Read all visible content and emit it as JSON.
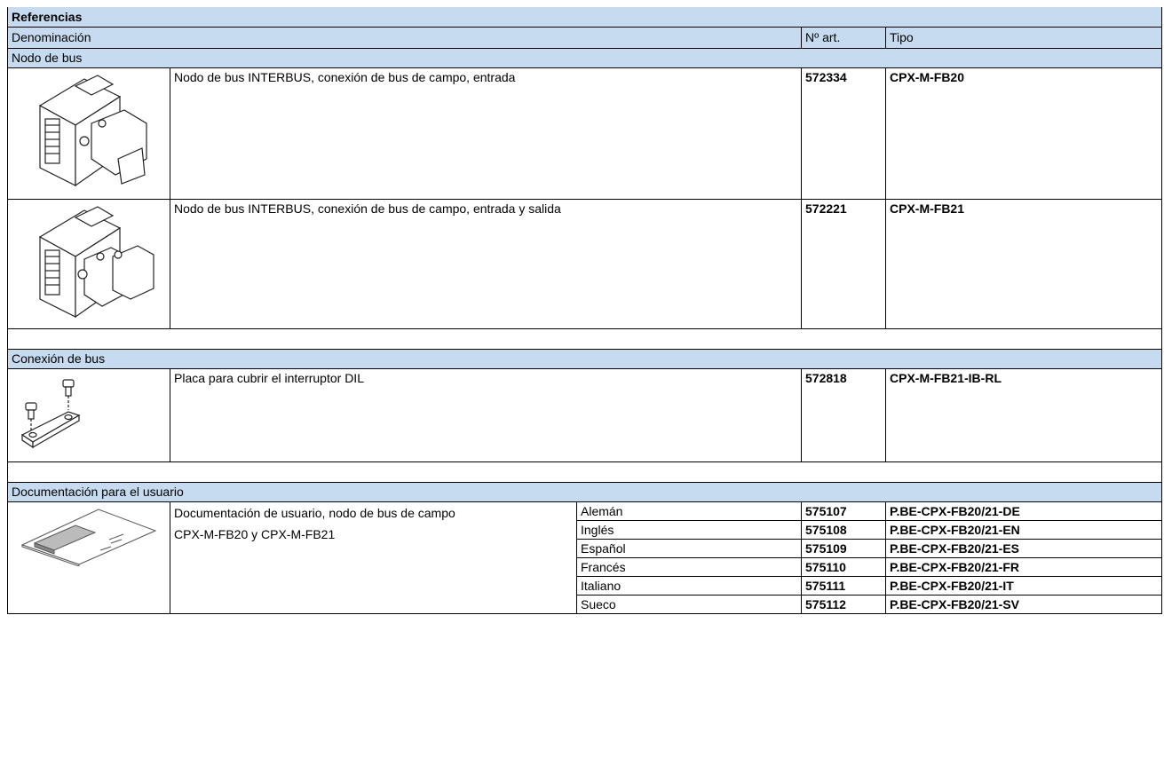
{
  "table": {
    "title": "Referencias",
    "columns": {
      "denominacion": "Denominación",
      "art": "Nº art.",
      "tipo": "Tipo"
    },
    "sections": [
      {
        "label": "Nodo de bus",
        "rows": [
          {
            "image": "bus-node-module-icon",
            "desc": "Nodo de bus INTERBUS, conexión de bus de campo, entrada",
            "art": "572334",
            "tipo": "CPX-M-FB20"
          },
          {
            "image": "bus-node-module-icon",
            "desc": "Nodo de bus INTERBUS, conexión de bus de campo, entrada y salida",
            "art": "572221",
            "tipo": "CPX-M-FB21"
          }
        ]
      },
      {
        "label": "Conexión de bus",
        "rows": [
          {
            "image": "cover-plate-icon",
            "desc": "Placa para cubrir el interruptor DIL",
            "art": "572818",
            "tipo": "CPX-M-FB21-IB-RL"
          }
        ]
      },
      {
        "label": "Documentación para el usuario",
        "doc_desc_line1": "Documentación de usuario, nodo de bus de campo",
        "doc_desc_line2": "CPX-M-FB20 y CPX-M-FB21",
        "image": "manual-booklet-icon",
        "rows": [
          {
            "lang": "Alemán",
            "art": "575107",
            "tipo": "P.BE-CPX-FB20/21-DE"
          },
          {
            "lang": "Inglés",
            "art": "575108",
            "tipo": "P.BE-CPX-FB20/21-EN"
          },
          {
            "lang": "Español",
            "art": "575109",
            "tipo": "P.BE-CPX-FB20/21-ES"
          },
          {
            "lang": "Francés",
            "art": "575110",
            "tipo": "P.BE-CPX-FB20/21-FR"
          },
          {
            "lang": "Italiano",
            "art": "575111",
            "tipo": "P.BE-CPX-FB20/21-IT"
          },
          {
            "lang": "Sueco",
            "art": "575112",
            "tipo": "P.BE-CPX-FB20/21-SV"
          }
        ]
      }
    ]
  },
  "colors": {
    "band": "#c6dbef",
    "line": "#000000"
  }
}
